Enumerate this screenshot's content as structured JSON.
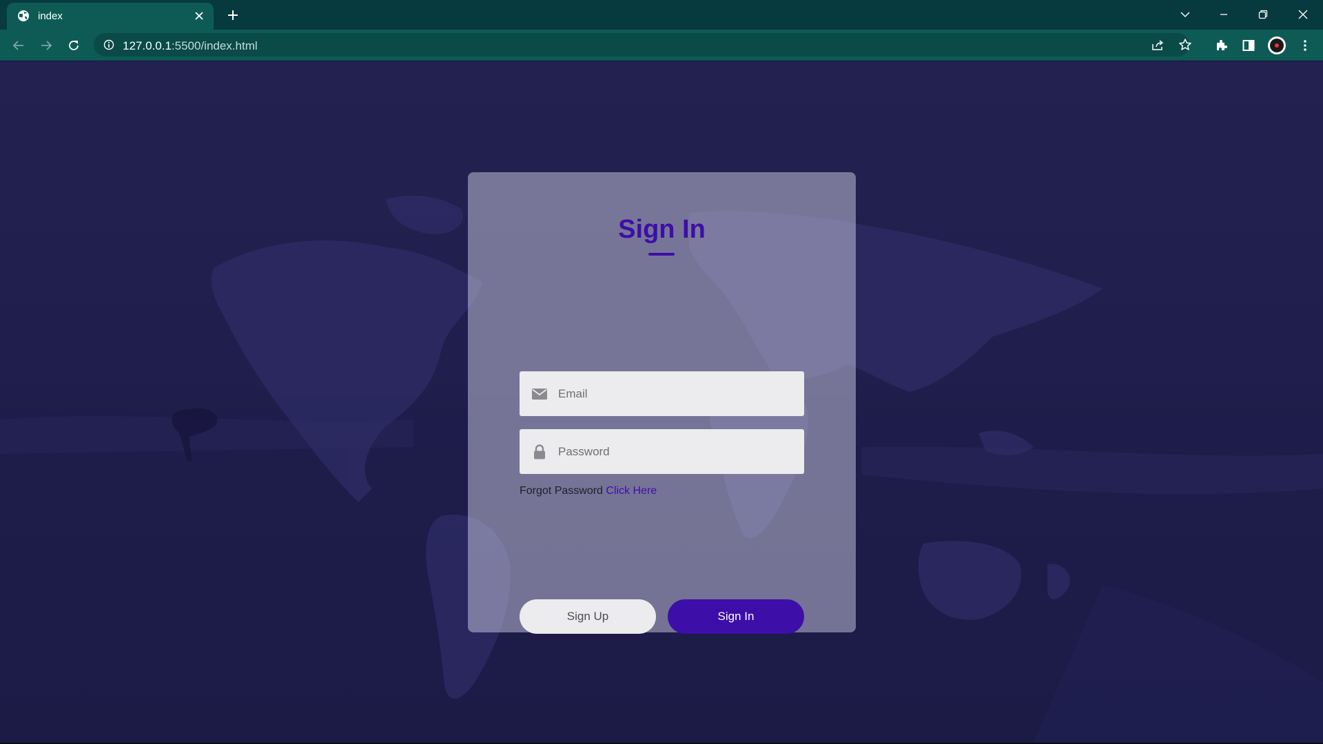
{
  "browser": {
    "tab": {
      "title": "index",
      "favicon": "globe-icon"
    },
    "url": {
      "host": "127.0.0.1",
      "rest": ":5500/index.html"
    },
    "colors": {
      "frame": "#063a3e",
      "toolbar": "#0e5b56"
    }
  },
  "login": {
    "title": "Sign In",
    "email": {
      "placeholder": "Email",
      "value": "",
      "icon": "envelope-icon"
    },
    "password": {
      "placeholder": "Password",
      "value": "",
      "icon": "lock-icon"
    },
    "forgot": {
      "text": "Forgot Password",
      "link": "Click Here"
    },
    "signup_label": "Sign Up",
    "signin_label": "Sign In",
    "colors": {
      "accent": "#3d0ea8",
      "background": "#1b1a45"
    }
  }
}
